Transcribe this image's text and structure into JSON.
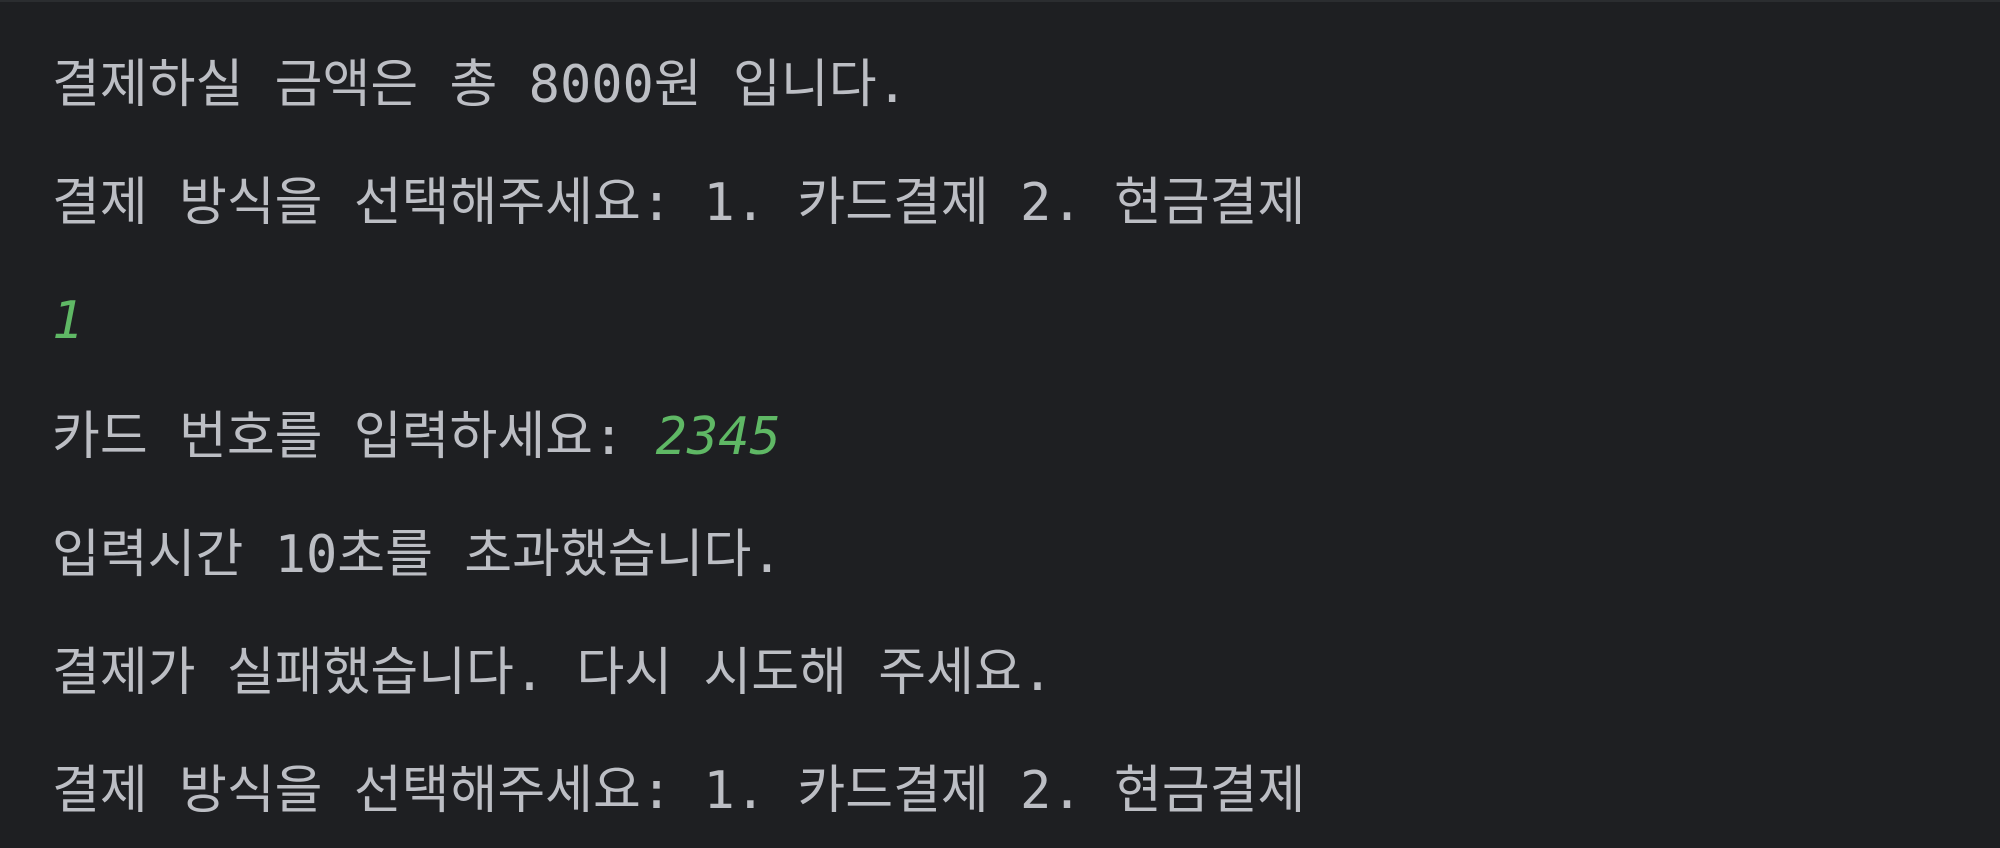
{
  "console": {
    "lines": [
      {
        "text": "결제하실 금액은 총 8000원 입니다."
      },
      {
        "text": "결제 방식을 선택해주세요: 1. 카드결제 2. 현금결제"
      },
      {
        "input": "1"
      },
      {
        "prompt": "카드 번호를 입력하세요: ",
        "input": "2345"
      },
      {
        "text": "입력시간 10초를 초과했습니다."
      },
      {
        "text": "결제가 실패했습니다. 다시 시도해 주세요."
      },
      {
        "text": "결제 방식을 선택해주세요: 1. 카드결제 2. 현금결제"
      }
    ]
  },
  "colors": {
    "background": "#1e1f22",
    "output_text": "#bcbec4",
    "user_input": "#5fb865"
  }
}
